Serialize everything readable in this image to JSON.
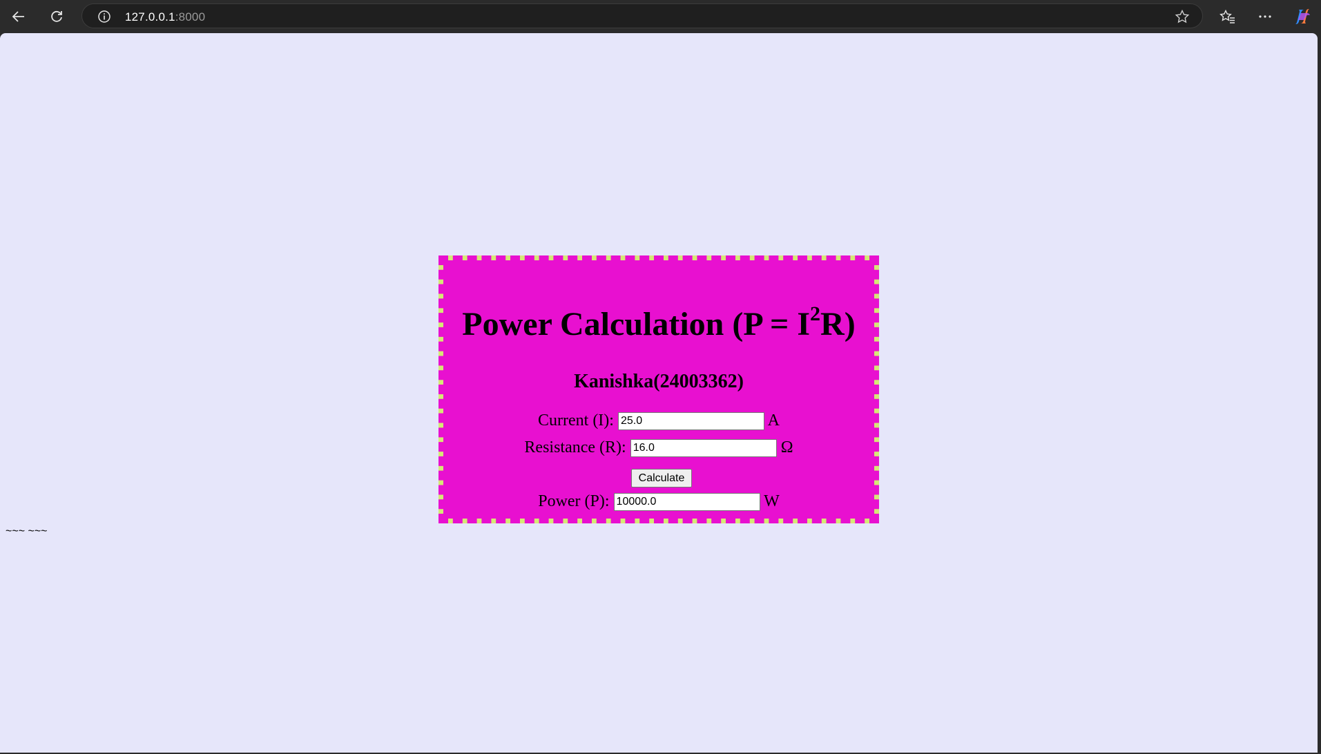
{
  "browser": {
    "url_host": "127.0.0.1",
    "url_port": ":8000",
    "icons": [
      "back-icon",
      "refresh-icon",
      "info-icon",
      "star-icon",
      "favorites-icon",
      "more-icon",
      "copilot-icon"
    ]
  },
  "page": {
    "title_main": "Power Calculation (P = I",
    "title_sup": "2",
    "title_end": "R)",
    "author": "Kanishka(24003362)",
    "current_label": "Current (I):",
    "current_value": "25.0",
    "current_unit": "A",
    "resistance_label": "Resistance (R):",
    "resistance_value": "16.0",
    "resistance_unit": "Ω",
    "calculate_label": "Calculate",
    "power_label": "Power (P):",
    "power_value": "10000.0",
    "power_unit": "W",
    "footer_text": "~~~ ~~~"
  },
  "colors": {
    "page_bg": "#e6e6fa",
    "card_bg": "#e810d0",
    "border_alt": "#d6e876"
  }
}
